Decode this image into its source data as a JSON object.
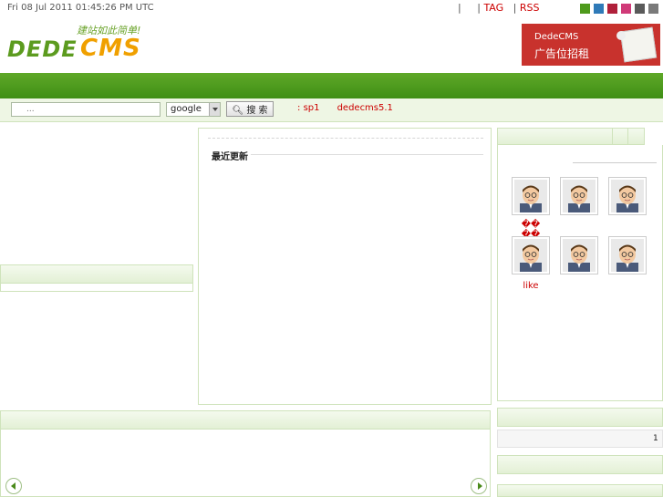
{
  "header": {
    "date": "Fri 08 Jul 2011 01:45:26 PM UTC",
    "links": [
      {
        "sep": "|",
        "label": ""
      },
      {
        "sep": "|",
        "label": "TAG"
      },
      {
        "sep": "|",
        "label": "RSS"
      }
    ],
    "skin_colors": [
      "#4e9a1c",
      "#2f7ab8",
      "#b0203a",
      "#d03a78",
      "#5a5a5a",
      "#7a7a7a"
    ]
  },
  "logo": {
    "text_a": "DEDE",
    "text_b": "CMS",
    "slogan": "建站如此简单!",
    "colors": {
      "green": "#5c9b1f",
      "orange": "#f0a000"
    }
  },
  "ad": {
    "line1": "DedeCMS",
    "line2": "广告位招租",
    "color": "#c8322d"
  },
  "search": {
    "placeholder": "...",
    "engine": "google",
    "button_label": "搜 索",
    "hot_prefix": ":",
    "hot_words": [
      "sp1",
      "dedecms5.1"
    ]
  },
  "main": {
    "recent_label": "最近更新"
  },
  "members": [
    {
      "name": "�� ��"
    },
    {
      "name": ""
    },
    {
      "name": ""
    },
    {
      "name": "like"
    },
    {
      "name": ""
    },
    {
      "name": ""
    }
  ],
  "sidebar2": {
    "count": "1"
  },
  "accent": "#4e9a1c"
}
